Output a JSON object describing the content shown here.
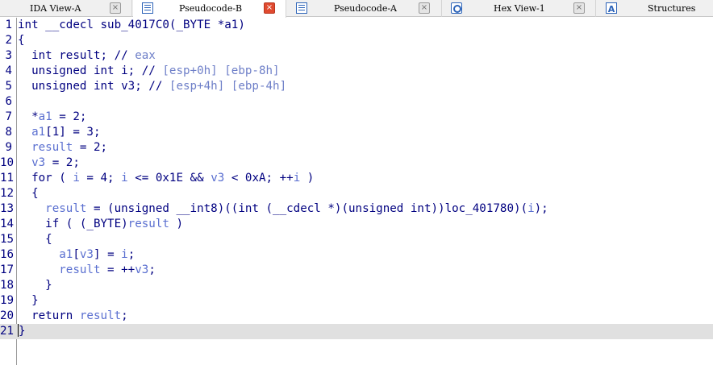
{
  "tabs": [
    {
      "label": "IDA View-A",
      "active": false,
      "close": "×"
    },
    {
      "label": "Pseudocode-B",
      "active": true,
      "close": "×"
    },
    {
      "label": "Pseudocode-A",
      "active": false,
      "close": "×"
    },
    {
      "label": "Hex View-1",
      "active": false,
      "close": "×"
    },
    {
      "label": "Structures",
      "active": false,
      "icon_text": "A"
    }
  ],
  "lines": [
    {
      "n": "1",
      "text": "int __cdecl sub_4017C0(_BYTE *a1)"
    },
    {
      "n": "2",
      "text": "{"
    },
    {
      "n": "3",
      "text": "  int result; // eax"
    },
    {
      "n": "4",
      "text": "  unsigned int i; // [esp+0h] [ebp-8h]"
    },
    {
      "n": "5",
      "text": "  unsigned int v3; // [esp+4h] [ebp-4h]"
    },
    {
      "n": "6",
      "text": ""
    },
    {
      "n": "7",
      "text": "  *a1 = 2;"
    },
    {
      "n": "8",
      "text": "  a1[1] = 3;"
    },
    {
      "n": "9",
      "text": "  result = 2;"
    },
    {
      "n": "10",
      "text": "  v3 = 2;"
    },
    {
      "n": "11",
      "text": "  for ( i = 4; i <= 0x1E && v3 < 0xA; ++i )"
    },
    {
      "n": "12",
      "text": "  {"
    },
    {
      "n": "13",
      "text": "    result = (unsigned __int8)((int (__cdecl *)(unsigned int))loc_401780)(i);"
    },
    {
      "n": "14",
      "text": "    if ( (_BYTE)result )"
    },
    {
      "n": "15",
      "text": "    {"
    },
    {
      "n": "16",
      "text": "      a1[v3] = i;"
    },
    {
      "n": "17",
      "text": "      result = ++v3;"
    },
    {
      "n": "18",
      "text": "    }"
    },
    {
      "n": "19",
      "text": "  }"
    },
    {
      "n": "20",
      "text": "  return result;"
    },
    {
      "n": "21",
      "text": "}"
    }
  ],
  "current_line": "21",
  "colors": {
    "keyword": "#000080",
    "variable": "#5a6fd0",
    "comment": "#6e7fc8",
    "current_line_bg": "#e0e0e0",
    "active_close": "#e04a2f"
  }
}
